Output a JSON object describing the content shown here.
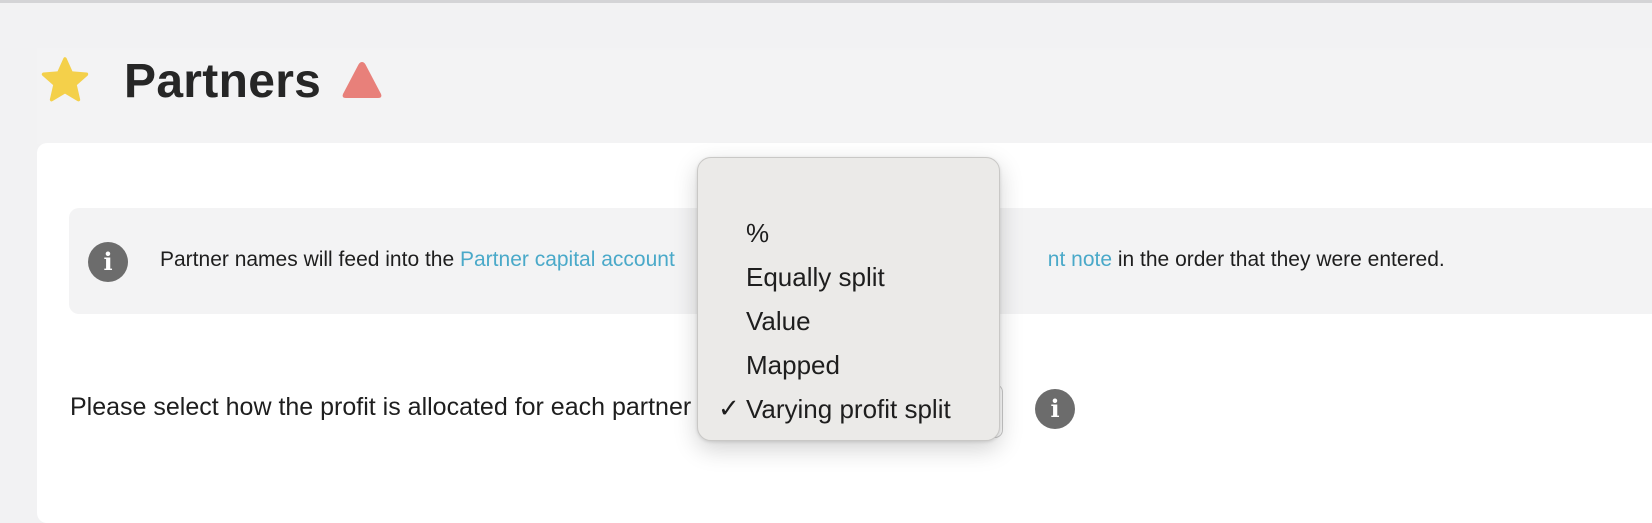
{
  "page": {
    "title": "Partners"
  },
  "icons": {
    "favorite": "star-icon",
    "warning": "warning-triangle-icon",
    "info": "info-icon"
  },
  "colors": {
    "star": "#f4d04a",
    "warning": "#e8807a",
    "link": "#4aa9c9",
    "info_icon": "#6c6c6c"
  },
  "info_banner": {
    "text_before": "Partner names will feed into the ",
    "link1": "Partner capital account",
    "link2_visible": "nt note",
    "text_after": " in the order that they were entered."
  },
  "profit_allocation": {
    "label": "Please select how the profit is allocated for each partner",
    "options": [
      {
        "label": "",
        "selected": false
      },
      {
        "label": "%",
        "selected": false
      },
      {
        "label": "Equally split",
        "selected": false
      },
      {
        "label": "Value",
        "selected": false
      },
      {
        "label": "Mapped",
        "selected": false
      },
      {
        "label": "Varying profit split",
        "selected": true
      }
    ],
    "check_mark": "✓"
  }
}
